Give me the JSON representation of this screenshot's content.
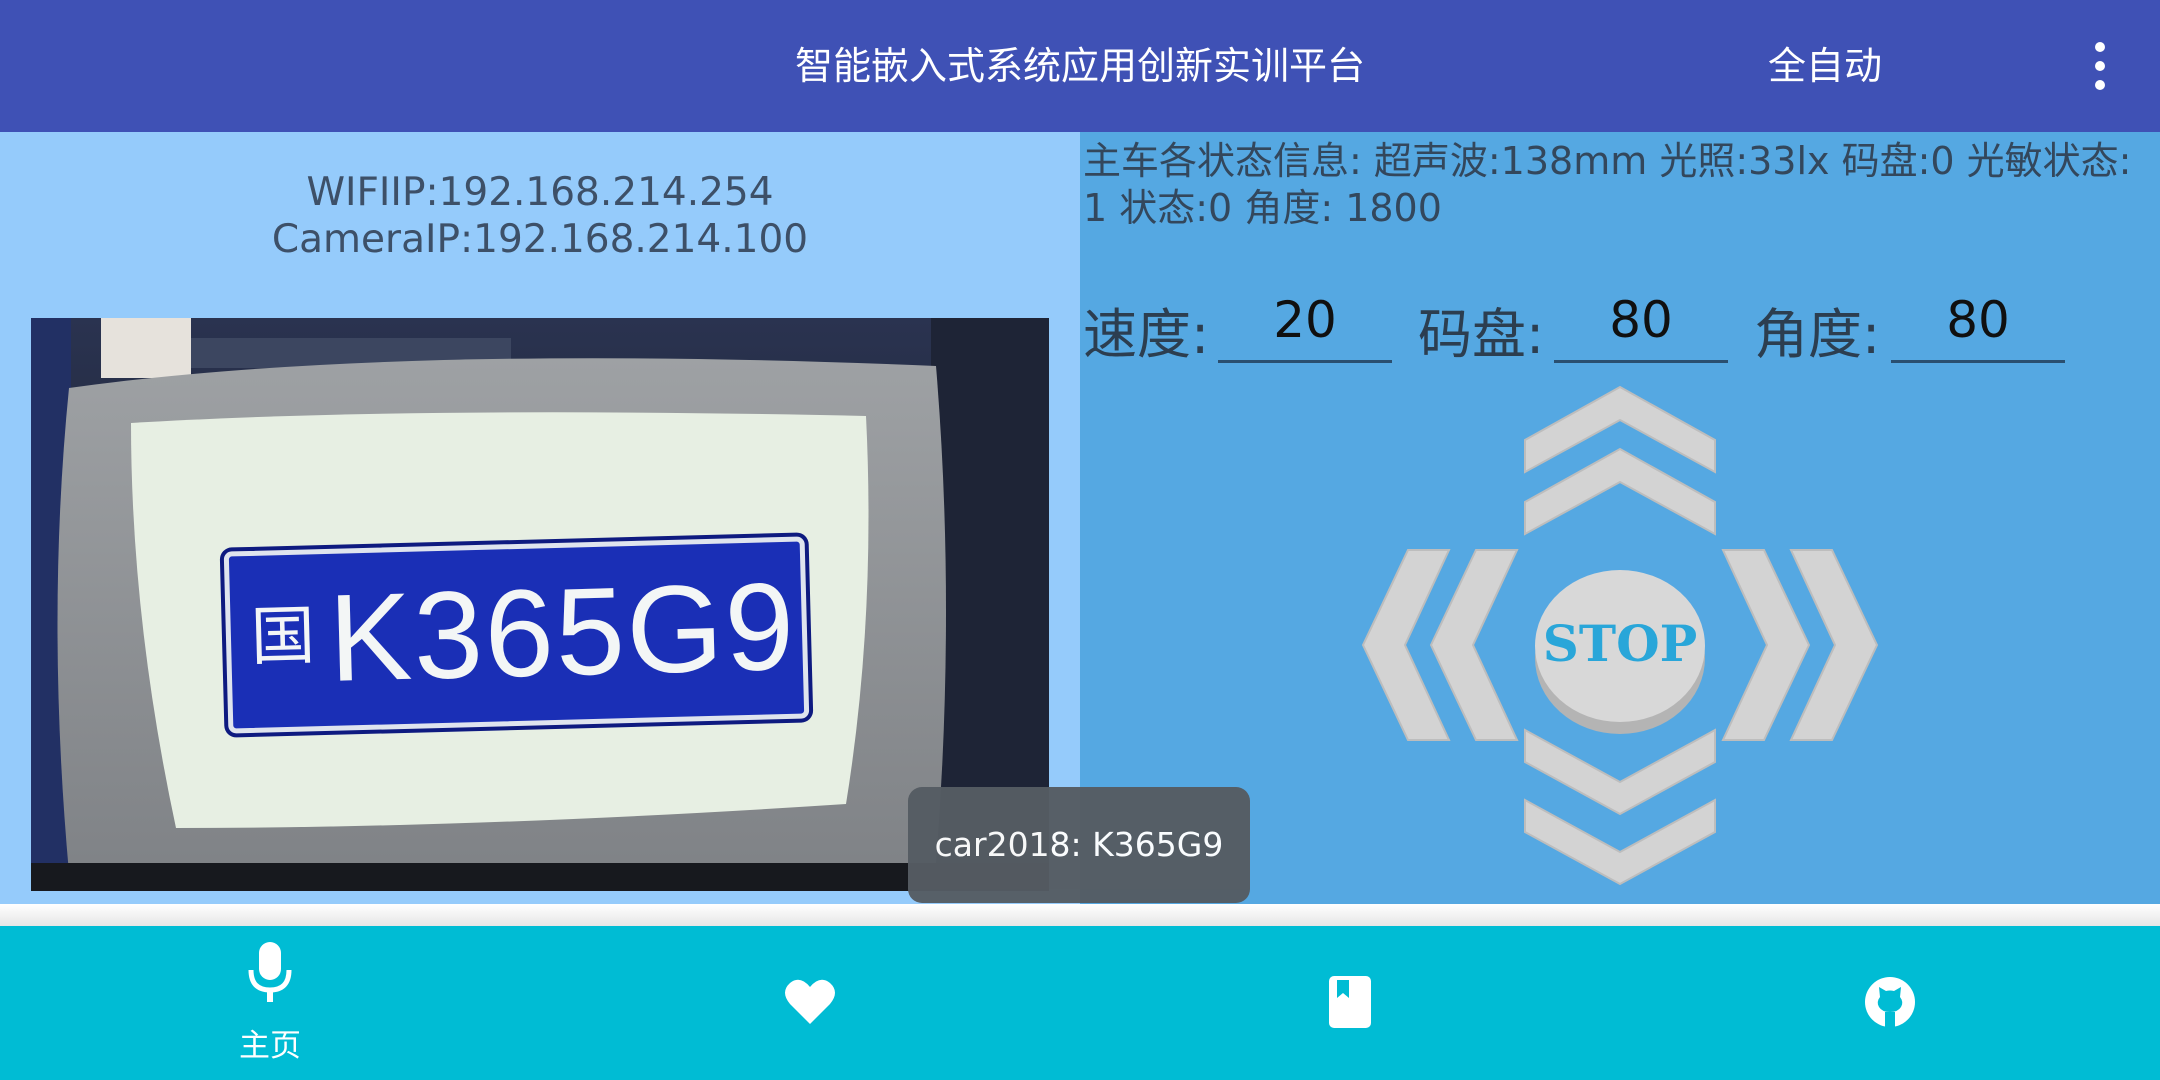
{
  "app_bar": {
    "title": "智能嵌入式系统应用创新实训平台",
    "mode": "全自动",
    "more_icon": "more-vert-icon"
  },
  "connection": {
    "wifi_ip": "WIFIIP:192.168.214.254",
    "camera_ip": "CameraIP:192.168.214.100"
  },
  "camera_view": {
    "plate_prefix": "国",
    "plate_text": "K365G9"
  },
  "status": {
    "line1": "主车各状态信息: 超声波:138mm 光照:33lx 码盘:0 光敏状态:",
    "line2": "1 状态:0 角度: 1800"
  },
  "controls": {
    "speed_label": "速度:",
    "speed_value": "20",
    "encoder_label": "码盘:",
    "encoder_value": "80",
    "angle_label": "角度:",
    "angle_value": "80"
  },
  "dpad": {
    "stop_label": "STOP",
    "up_icon": "chevron-double-up-icon",
    "down_icon": "chevron-double-down-icon",
    "left_icon": "chevron-double-left-icon",
    "right_icon": "chevron-double-right-icon"
  },
  "toast": {
    "text": "car2018: K365G9"
  },
  "bottom_nav": {
    "items": [
      {
        "icon": "mic-icon",
        "label": "主页"
      },
      {
        "icon": "heart-icon",
        "label": ""
      },
      {
        "icon": "book-icon",
        "label": ""
      },
      {
        "icon": "github-icon",
        "label": ""
      }
    ]
  },
  "colors": {
    "app_bar": "#3f51b5",
    "left_panel": "#95cbfb",
    "right_panel": "#55a8e2",
    "bottom_nav": "#00bcd4",
    "stop_text": "#29a6d9"
  }
}
